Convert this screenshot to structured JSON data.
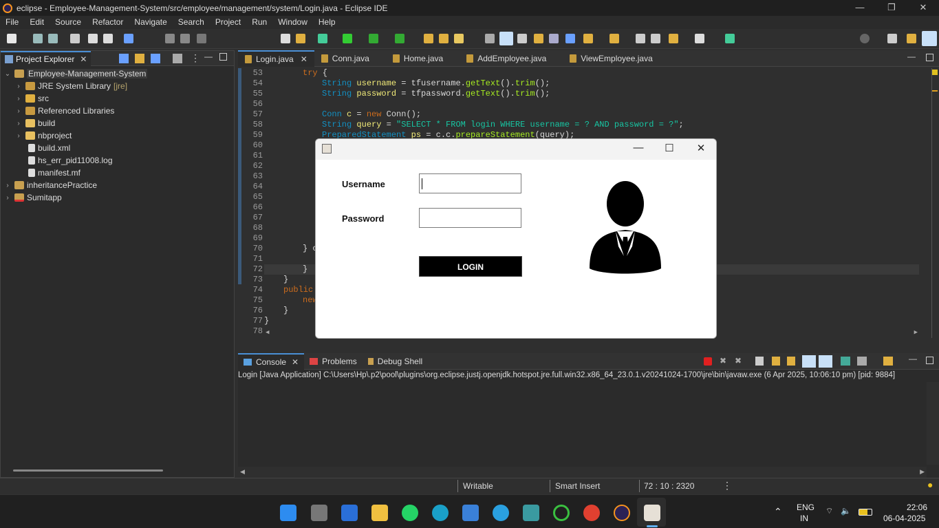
{
  "window": {
    "title": "eclipse - Employee-Management-System/src/employee/management/system/Login.java - Eclipse IDE",
    "minimize": "—",
    "restore": "❐",
    "close": "✕"
  },
  "menu": [
    "File",
    "Edit",
    "Source",
    "Refactor",
    "Navigate",
    "Search",
    "Project",
    "Run",
    "Window",
    "Help"
  ],
  "project_explorer": {
    "tab_label": "Project Explorer",
    "items": [
      {
        "label": "Employee-Management-System",
        "extra": ""
      },
      {
        "label": "JRE System Library",
        "extra": "[jre]"
      },
      {
        "label": "src",
        "extra": ""
      },
      {
        "label": "Referenced Libraries",
        "extra": ""
      },
      {
        "label": "build",
        "extra": ""
      },
      {
        "label": "nbproject",
        "extra": ""
      },
      {
        "label": "build.xml",
        "extra": ""
      },
      {
        "label": "hs_err_pid11008.log",
        "extra": ""
      },
      {
        "label": "manifest.mf",
        "extra": ""
      },
      {
        "label": "inheritancePractice",
        "extra": ""
      },
      {
        "label": "Sumitapp",
        "extra": ""
      }
    ]
  },
  "editor": {
    "tabs": [
      "Login.java",
      "Conn.java",
      "Home.java",
      "AddEmployee.java",
      "ViewEmployee.java"
    ],
    "line_numbers": [
      "53",
      "54",
      "55",
      "56",
      "57",
      "58",
      "59",
      "60",
      "61",
      "62",
      "63",
      "64",
      "65",
      "66",
      "67",
      "68",
      "69",
      "70",
      "71",
      "72",
      "73",
      "74",
      "75",
      "76",
      "77",
      "78"
    ],
    "code": {
      "l53_kw": "try",
      "l53_rest": " {",
      "l54_type": "String",
      "l54_var": "username",
      "l54_mid": " = tfusername.",
      "l54_m1": "getText",
      "l54_m2": "trim",
      "l55_type": "String",
      "l55_var": "password",
      "l55_mid": " = tfpassword.",
      "l55_m1": "getText",
      "l55_m2": "trim",
      "l57_type": "Conn",
      "l57_var": "c",
      "l57_kw": "new",
      "l57_rest": " Conn();",
      "l58_type": "String",
      "l58_var": "query",
      "l58_str": "\"SELECT * FROM login WHERE username = ? AND password = ?\"",
      "l59_type": "PreparedStatement",
      "l59_var": "ps",
      "l59_mid": " = c.c.",
      "l59_m": "prepareStatement",
      "l59_rest": "(query);",
      "l70": "} c",
      "l72": "}",
      "l73": "}",
      "l74": "public",
      "l75": "new",
      "l76": "}",
      "l77": "}"
    }
  },
  "console": {
    "tabs": [
      "Console",
      "Problems",
      "Debug Shell"
    ],
    "info": "Login [Java Application] C:\\Users\\Hp\\.p2\\pool\\plugins\\org.eclipse.justj.openjdk.hotspot.jre.full.win32.x86_64_23.0.1.v20241024-1700\\jre\\bin\\javaw.exe (6 Apr 2025, 10:06:10 pm) [pid: 9884]"
  },
  "status": {
    "writable": "Writable",
    "insert_mode": "Smart Insert",
    "position": "72 : 10 : 2320"
  },
  "login_dialog": {
    "username_label": "Username",
    "password_label": "Password",
    "username_value": "",
    "password_value": "",
    "login_button": "LOGIN"
  },
  "taskbar": {
    "lang_top": "ENG",
    "lang_bottom": "IN",
    "time": "22:06",
    "date": "06-04-2025"
  }
}
